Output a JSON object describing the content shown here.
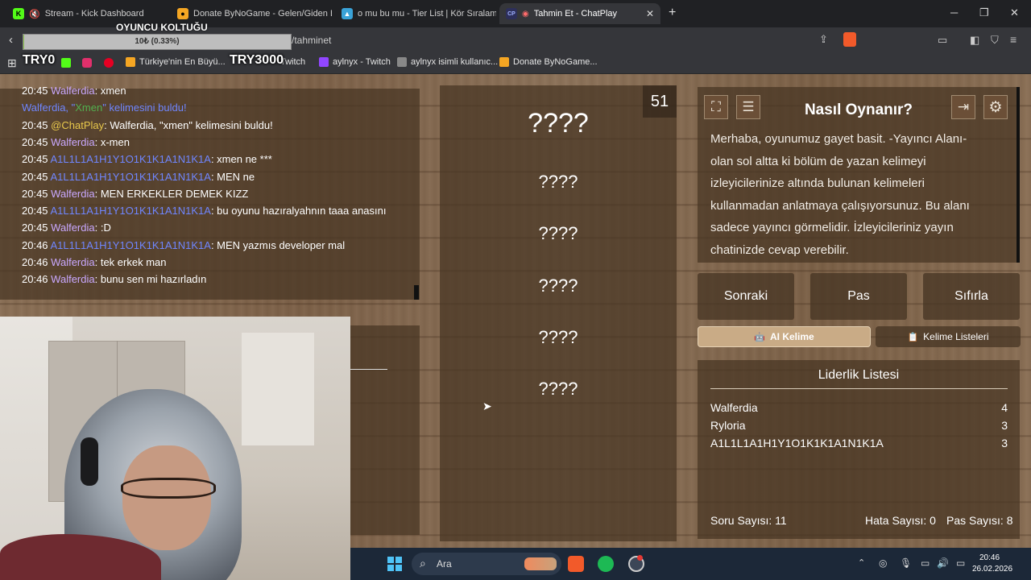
{
  "tabs": [
    {
      "label": "Stream - Kick Dashboard",
      "icon": "kick-icon"
    },
    {
      "label": "Donate ByNoGame - Gelen/Giden Ba",
      "icon": "bynogame-icon"
    },
    {
      "label": "o mu bu mu - Tier List | Kör Sıralama",
      "icon": "tierlist-icon"
    },
    {
      "label": "Tahmin Et - ChatPlay",
      "icon": "chatplay-icon"
    }
  ],
  "address": {
    "url_fragment": "/tahminet"
  },
  "bookmarks": [
    {
      "label": "Türkiye'nin En Büyü..."
    },
    {
      "label": "Twitch"
    },
    {
      "label": "aylnyx - Twitch"
    },
    {
      "label": "aylnyx isimli kullanıc..."
    },
    {
      "label": "Donate ByNoGame..."
    }
  ],
  "overlay": {
    "seat_title": "OYUNCU KOLTUĞU",
    "progress_text": "10₺ (0.33%)",
    "progress_fraction": 0.0033,
    "try_left": "TRY0",
    "try_right": "TRY3000"
  },
  "chat": [
    {
      "time": "20:45",
      "user": "Walferdia",
      "msg": "xmen",
      "ucolor": "purple"
    },
    {
      "sys": true,
      "pre": "Walferdia, \"",
      "hl": "Xmen",
      "post": "\" kelimesini buldu!"
    },
    {
      "time": "20:45",
      "user": "@ChatPlay",
      "msg": "Walferdia, \"xmen\" kelimesini buldu!",
      "ucolor": "chatplay"
    },
    {
      "time": "20:45",
      "user": "Walferdia",
      "msg": "x-men",
      "ucolor": "purple"
    },
    {
      "time": "20:45",
      "user": "A1L1L1A1H1Y1O1K1K1A1N1K1A",
      "msg": "xmen ne ***",
      "ucolor": "blue"
    },
    {
      "time": "20:45",
      "user": "A1L1L1A1H1Y1O1K1K1A1N1K1A",
      "msg": "MEN ne",
      "ucolor": "blue"
    },
    {
      "time": "20:45",
      "user": "Walferdia",
      "msg": "MEN ERKEKLER DEMEK KIZZ",
      "ucolor": "purple"
    },
    {
      "time": "20:45",
      "user": "A1L1L1A1H1Y1O1K1K1A1N1K1A",
      "msg": "bu oyunu hazıralyahnın taaa anasını",
      "ucolor": "blue"
    },
    {
      "time": "20:45",
      "user": "Walferdia",
      "msg": ":D",
      "ucolor": "purple"
    },
    {
      "time": "20:46",
      "user": "A1L1L1A1H1Y1O1K1K1A1N1K1A",
      "msg": "MEN yazmıs developer mal",
      "ucolor": "blue"
    },
    {
      "time": "20:46",
      "user": "Walferdia",
      "msg": "tek erkek man",
      "ucolor": "purple"
    },
    {
      "time": "20:46",
      "user": "Walferdia",
      "msg": "bunu sen mi hazırladın",
      "ucolor": "purple"
    }
  ],
  "words": {
    "timer": "51",
    "main": "????",
    "forbidden": [
      "????",
      "????",
      "????",
      "????",
      "????"
    ]
  },
  "howto": {
    "title": "Nasıl Oynanır?",
    "lines": [
      "Merhaba, oyunumuz gayet basit. -Yayıncı Alanı-",
      "olan sol altta ki bölüm de yazan kelimeyi",
      "izleyicilerinize altında bulunan kelimeleri",
      "kullanmadan anlatmaya çalışıyorsunuz. Bu alanı",
      "sadece yayıncı görmelidir. İzleyicileriniz yayın",
      "chatinizde cevap verebilir."
    ]
  },
  "controls": {
    "next": "Sonraki",
    "pass": "Pas",
    "reset": "Sıfırla"
  },
  "modes": {
    "ai": "AI Kelime",
    "lists": "Kelime Listeleri"
  },
  "leaderboard": {
    "title": "Liderlik Listesi",
    "rows": [
      {
        "name": "Walferdia",
        "score": "4"
      },
      {
        "name": "Ryloria",
        "score": "3"
      },
      {
        "name": "A1L1L1A1H1Y1O1K1K1A1N1K1A",
        "score": "3"
      }
    ],
    "stats": {
      "questions": "Soru Sayısı: 11",
      "errors": "Hata Sayısı: 0",
      "passes": "Pas Sayısı: 8"
    }
  },
  "taskbar": {
    "search": "Ara",
    "time": "20:46",
    "date": "26.02.2026"
  }
}
